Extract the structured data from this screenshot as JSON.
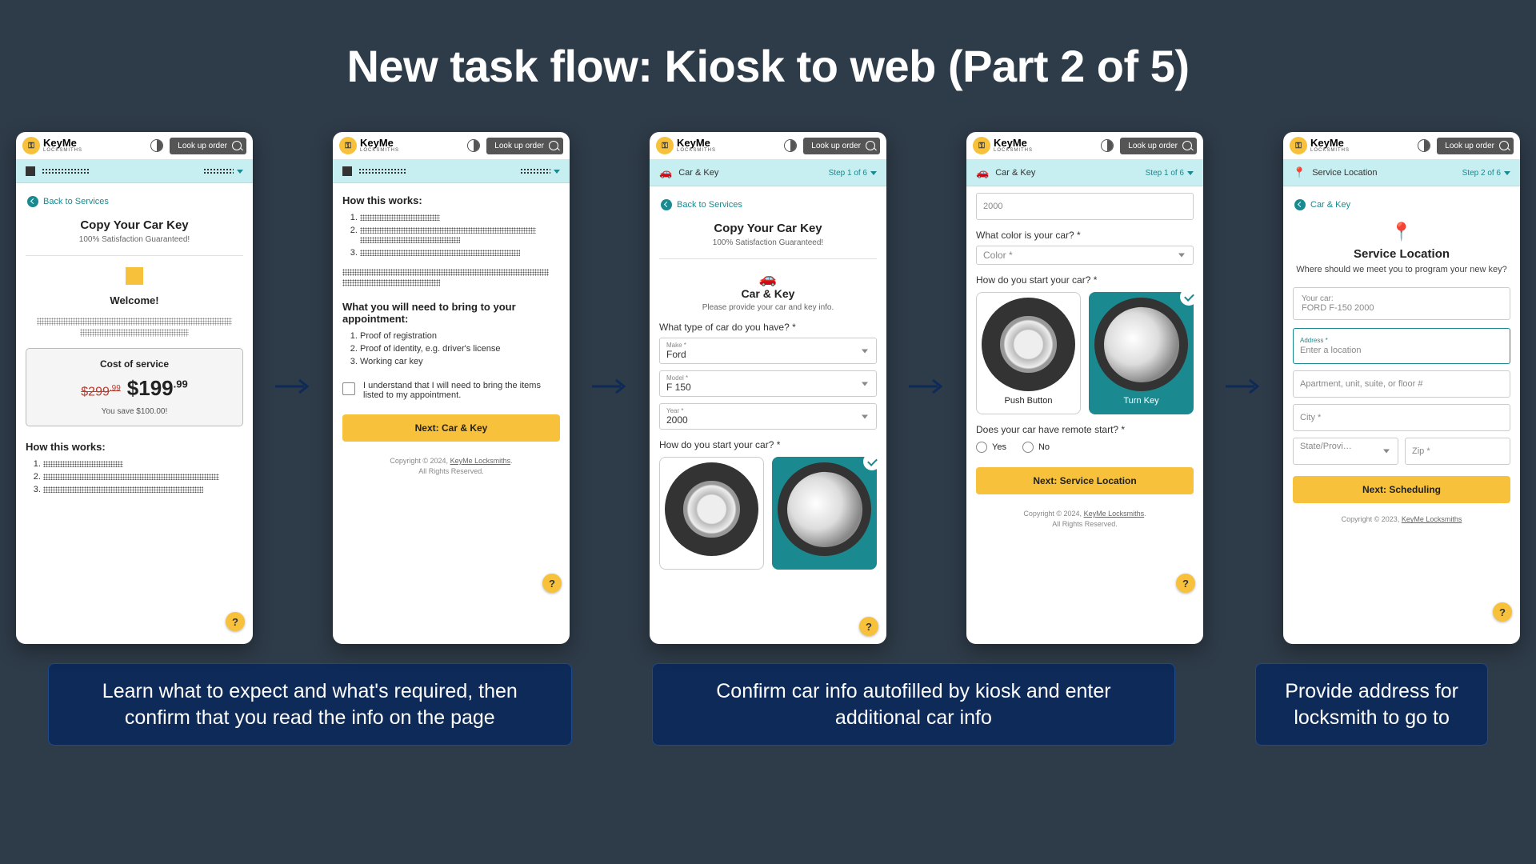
{
  "slideTitle": "New task flow: Kiosk to web (Part 2 of 5)",
  "common": {
    "brand": "KeyMe",
    "brandSub": "LOCKSMITHS",
    "lookup": "Look up order",
    "backToServices": "Back to Services",
    "copyright": "Copyright © 2024, ",
    "copyright2023": "Copyright © 2023, ",
    "company": "KeyMe Locksmiths",
    "rights": "All Rights Reserved.",
    "help": "?"
  },
  "s1": {
    "title": "Copy Your Car Key",
    "subtitle": "100% Satisfaction Guaranteed!",
    "welcome": "Welcome!",
    "costTitle": "Cost of service",
    "oldPrice": "$299",
    "oldCents": ".99",
    "newPrice": "$199",
    "newCents": ".99",
    "save": "You save $100.00!",
    "howTitle": "How this works:"
  },
  "s2": {
    "howTitle": "How this works:",
    "bringTitle": "What you will need to bring to your appointment:",
    "items": [
      "Proof of registration",
      "Proof of identity, e.g. driver's license",
      "Working car key"
    ],
    "ack": "I understand that I will need to bring the items listed to my appointment.",
    "cta": "Next: Car & Key"
  },
  "s3": {
    "title": "Copy Your Car Key",
    "subtitle": "100% Satisfaction Guaranteed!",
    "section": "Car & Key",
    "sectionSub": "Please provide your car and key info.",
    "qType": "What type of car do you have? *",
    "makeLabel": "Make *",
    "makeVal": "Ford",
    "modelLabel": "Model *",
    "modelVal": "F 150",
    "yearLabel": "Year *",
    "yearVal": "2000",
    "qStart": "How do you start your car? *"
  },
  "s4": {
    "crumb": "Car & Key",
    "step": "Step 1 of 6",
    "yearVal": "2000",
    "qColor": "What color is your car? *",
    "colorPh": "Color *",
    "qStart": "How do you start your car? *",
    "push": "Push Button",
    "turn": "Turn Key",
    "qRemote": "Does your car have remote start? *",
    "yes": "Yes",
    "no": "No",
    "cta": "Next: Service Location"
  },
  "s5": {
    "crumb": "Service Location",
    "step": "Step 2 of 6",
    "back": "Car & Key",
    "title": "Service Location",
    "subtitle": "Where should we meet you to program your new key?",
    "yourCarLbl": "Your car:",
    "yourCarVal": "FORD F-150 2000",
    "addrLabel": "Address *",
    "addrPh": "Enter a location",
    "aptPh": "Apartment, unit, suite, or floor #",
    "cityPh": "City *",
    "statePh": "State/Provi…",
    "zipPh": "Zip *",
    "cta": "Next: Scheduling"
  },
  "captions": {
    "c1": "Learn what to expect and what's required, then confirm that you read the info on the page",
    "c2": "Confirm car info autofilled by kiosk and enter additional car info",
    "c3": "Provide address for locksmith to go to"
  }
}
